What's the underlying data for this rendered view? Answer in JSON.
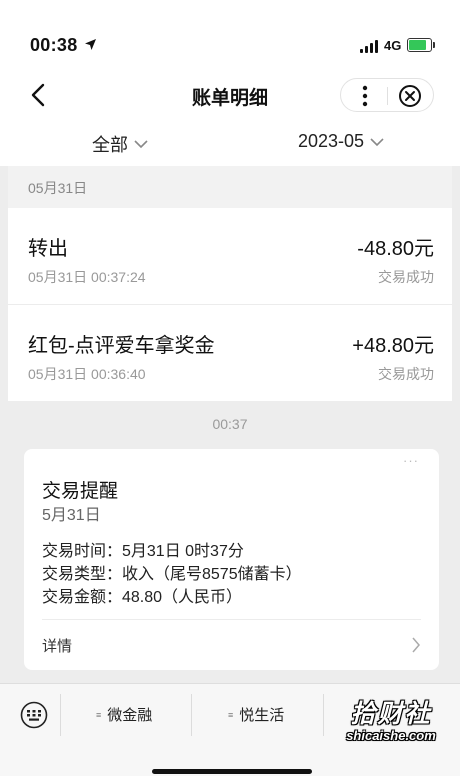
{
  "status_bar": {
    "time": "00:38",
    "network": "4G",
    "battery_level": 0.8
  },
  "header": {
    "title": "账单明细",
    "back_icon": "chevron-left-icon",
    "more_icon": "more-vertical-icon",
    "close_icon": "circle-close-icon"
  },
  "filters": {
    "type": "全部",
    "month": "2023-05"
  },
  "date_group": "05月31日",
  "transactions": [
    {
      "title": "转出",
      "amount": "-48.80元",
      "time": "05月31日 00:37:24",
      "status": "交易成功"
    },
    {
      "title": "红包-点评爱车拿奖金",
      "amount": "+48.80元",
      "time": "05月31日 00:36:40",
      "status": "交易成功"
    }
  ],
  "chat": {
    "timestamp": "00:37",
    "card": {
      "dots": "···",
      "title": "交易提醒",
      "date": "5月31日",
      "details": [
        "交易时间：5月31日 0时37分",
        "交易类型：收入（尾号8575储蓄卡）",
        "交易金额：48.80（人民币）"
      ],
      "more": "详情"
    }
  },
  "bottom_menu": {
    "keyboard_icon": "keyboard-icon",
    "items": [
      "微金融",
      "悦生活"
    ],
    "glyph": "≡"
  },
  "watermark": {
    "main": "拾财社",
    "sub": "shicaishe.com"
  }
}
